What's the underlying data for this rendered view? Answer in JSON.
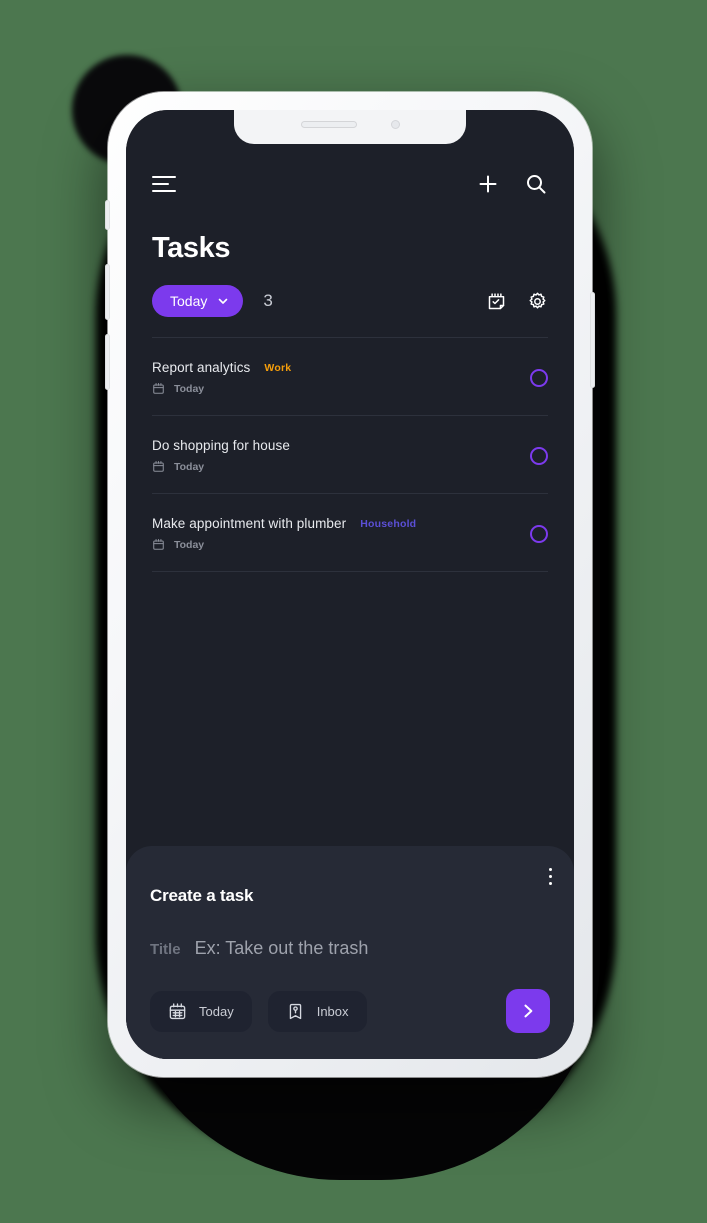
{
  "theme": {
    "background": "#4c774f",
    "screen_bg": "#1d2029",
    "panel_bg": "#262a36",
    "accent_purple": "#7c3aed",
    "tag_work": "#f59e0b",
    "tag_household": "#5b4fd6",
    "text_primary": "#ffffff",
    "text_muted": "#8b8f9a"
  },
  "topbar": {
    "menu_icon": "hamburger-menu-icon",
    "add_icon": "plus-icon",
    "search_icon": "search-icon"
  },
  "header": {
    "title": "Tasks"
  },
  "filter": {
    "pill_label": "Today",
    "pill_chevron": "chevron-down-icon",
    "count": "3",
    "note_icon": "note-check-icon",
    "settings_icon": "gear-icon"
  },
  "tasks": [
    {
      "title": "Report analytics",
      "tag": "Work",
      "tag_color": "#f59e0b",
      "date_icon": "calendar-icon",
      "date": "Today",
      "checkbox": "unchecked"
    },
    {
      "title": "Do shopping for house",
      "tag": "",
      "tag_color": "#5b4fd6",
      "date_icon": "calendar-icon",
      "date": "Today",
      "checkbox": "unchecked"
    },
    {
      "title": "Make appointment with plumber",
      "tag": "Household",
      "tag_color": "#5b4fd6",
      "date_icon": "calendar-icon",
      "date": "Today",
      "checkbox": "unchecked"
    }
  ],
  "create": {
    "kebab_icon": "more-vertical-icon",
    "heading": "Create a task",
    "title_label": "Title",
    "title_placeholder": "Ex: Take out the trash",
    "date_chip": {
      "icon": "calendar-icon",
      "label": "Today"
    },
    "list_chip": {
      "icon": "inbox-tag-icon",
      "label": "Inbox"
    },
    "submit_icon": "chevron-right-icon"
  }
}
